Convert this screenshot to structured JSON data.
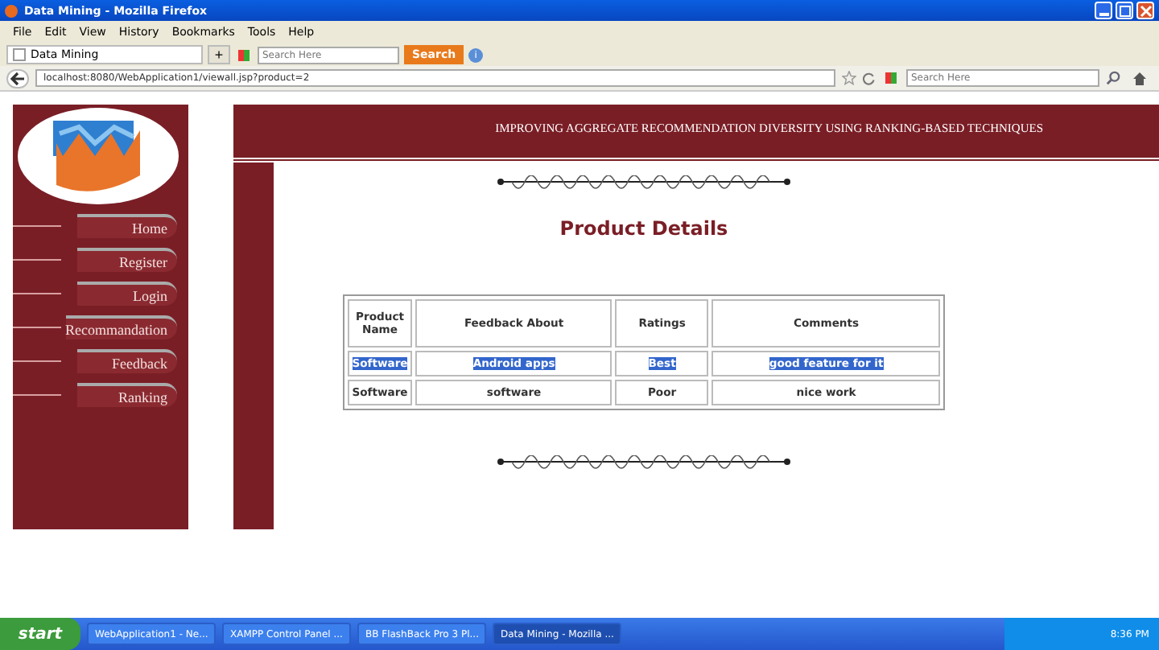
{
  "window": {
    "title": "Data Mining - Mozilla Firefox"
  },
  "menu": [
    "File",
    "Edit",
    "View",
    "History",
    "Bookmarks",
    "Tools",
    "Help"
  ],
  "tabs": [
    {
      "label": "Data Mining",
      "selected": true
    }
  ],
  "new_tab": "+",
  "toolbar_search": {
    "placeholder": "Search Here",
    "button": "Search",
    "info": "i"
  },
  "address": {
    "value": "localhost:8080/WebApplication1/viewall.jsp?product=2"
  },
  "nav_search": {
    "placeholder": "Search Here"
  },
  "page": {
    "header": "IMPROVING AGGREGATE RECOMMENDATION DIVERSITY USING RANKING-BASED TECHNIQUES",
    "heading": "Product Details"
  },
  "sidebar": {
    "items": [
      "Home",
      "Register",
      "Login",
      "Recommandation",
      "Feedback",
      "Ranking"
    ]
  },
  "table": {
    "columns": [
      "Product Name",
      "Feedback About",
      "Ratings",
      "Comments"
    ],
    "rows": [
      {
        "cells": [
          "Software",
          "Android apps",
          "Best",
          "good feature for it"
        ],
        "selected": true
      },
      {
        "cells": [
          "Software",
          "software",
          "Poor",
          "nice work"
        ],
        "selected": false
      }
    ]
  },
  "taskbar": {
    "start": "start",
    "items": [
      {
        "label": "WebApplication1 - Ne...",
        "selected": false
      },
      {
        "label": "XAMPP Control Panel ...",
        "selected": false
      },
      {
        "label": "BB FlashBack Pro 3 Pl...",
        "selected": false
      },
      {
        "label": "Data Mining - Mozilla ...",
        "selected": true
      }
    ],
    "clock": "8:36 PM"
  }
}
